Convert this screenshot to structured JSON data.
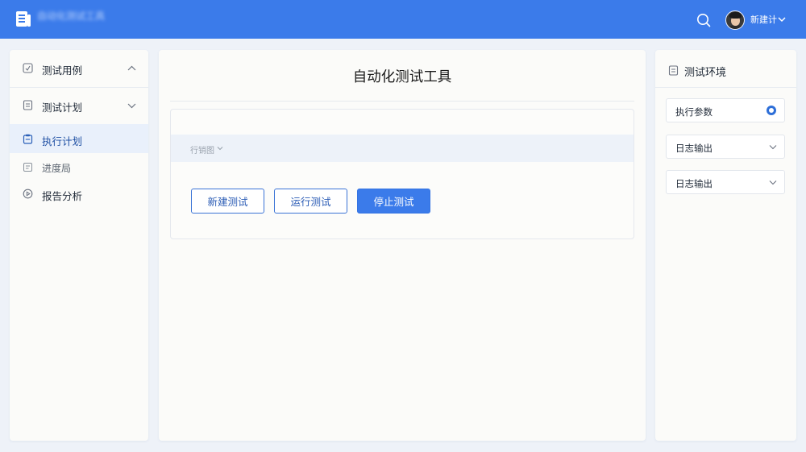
{
  "header": {
    "app_title": "自动化测试工具",
    "app_subtitle": "",
    "username": "新建计",
    "icons": [
      "document-logo-icon",
      "search-icon",
      "chevron-down-icon"
    ]
  },
  "sidebar": {
    "items": [
      {
        "label": "测试用例",
        "icon": "check-doc-icon",
        "expanded": true
      },
      {
        "label": "测试计划",
        "icon": "doc-icon",
        "expanded": false
      },
      {
        "label": "执行计划",
        "icon": "clipboard-icon",
        "active": true
      },
      {
        "label": "进度局",
        "icon": "list-doc-icon"
      },
      {
        "label": "报告分析",
        "icon": "circle-play-icon"
      }
    ]
  },
  "main": {
    "title": "自动化测试工具",
    "filter_label": "行销图",
    "buttons": {
      "new_test": "新建测试",
      "run_test": "运行测试",
      "stop_test": "停止测试"
    }
  },
  "right_panel": {
    "title": "测试环境",
    "fields": [
      {
        "label": "执行参数",
        "control": "radio"
      },
      {
        "label": "日志输出",
        "control": "dropdown"
      },
      {
        "label": "日志输出",
        "control": "dropdown"
      }
    ]
  },
  "colors": {
    "header_bg": "#3b7bea",
    "primary": "#3b7bea",
    "active_nav_bg": "#e9f0fb",
    "page_bg": "#eef2f8"
  }
}
